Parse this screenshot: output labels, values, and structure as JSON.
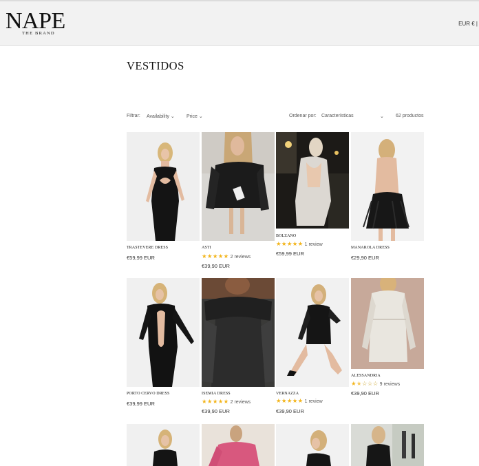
{
  "header": {
    "logo_text": "NAPE",
    "logo_sub": "THE BRAND",
    "currency": "EUR € |"
  },
  "page": {
    "title": "VESTIDOS"
  },
  "filters": {
    "filter_label": "Filtrar:",
    "availability": "Availability",
    "price": "Price",
    "sort_label": "Ordenar por:",
    "sort_value": "Características",
    "count": "62 productos"
  },
  "products": [
    {
      "name": "TRASTEVERE DRESS",
      "price": "€59,99 EUR",
      "reviews": ""
    },
    {
      "name": "ASTI",
      "price": "€39,90 EUR",
      "reviews": "2 reviews",
      "rating": 5
    },
    {
      "name": "BOLZANO",
      "price": "€59,99 EUR",
      "reviews": "1 review",
      "rating": 5
    },
    {
      "name": "MANAROLA DRESS",
      "price": "€29,90 EUR",
      "reviews": ""
    },
    {
      "name": "PORTO CERVO DRESS",
      "price": "€39,99 EUR",
      "reviews": ""
    },
    {
      "name": "ISEMIA DRESS",
      "price": "€39,90 EUR",
      "reviews": "2 reviews",
      "rating": 5
    },
    {
      "name": "VERNAZZA",
      "price": "€39,90 EUR",
      "reviews": "1 review",
      "rating": 5
    },
    {
      "name": "ALESSANDRIA",
      "price": "€39,90 EUR",
      "reviews": "9 reviews",
      "rating": 1.5
    }
  ],
  "colors": {
    "star": "#f3b51c",
    "header_bg": "#f2f2f2"
  }
}
